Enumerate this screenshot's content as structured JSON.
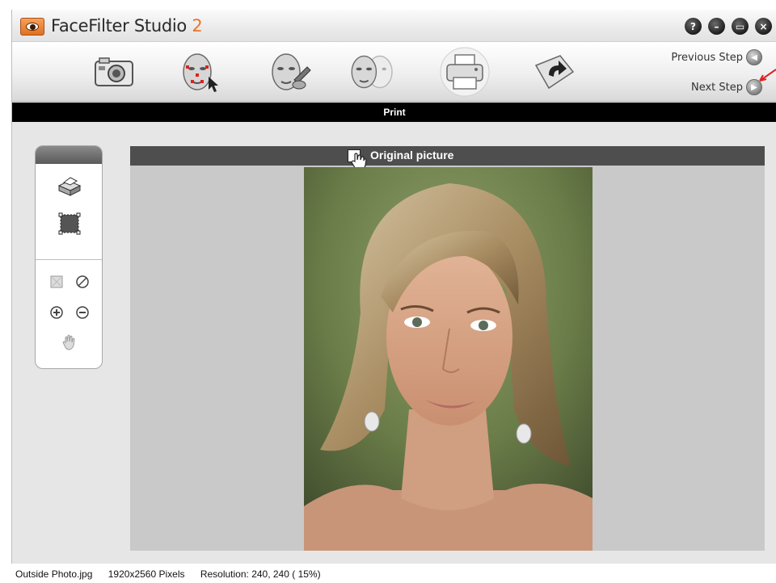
{
  "app": {
    "title": "FaceFilter Studio ",
    "version": "2"
  },
  "window_buttons": [
    {
      "name": "help-button",
      "glyph": "?"
    },
    {
      "name": "minimize-button",
      "glyph": "–"
    },
    {
      "name": "maximize-button",
      "glyph": "▭"
    },
    {
      "name": "close-button",
      "glyph": "×"
    }
  ],
  "toolbar": {
    "steps": [
      "camera-icon",
      "face-select-icon",
      "face-edit-icon",
      "face-compare-icon",
      "printer-icon",
      "undo-icon"
    ],
    "previous_step": "Previous Step",
    "next_step": "Next Step"
  },
  "step_header": "Print",
  "side_panel": {
    "tools": [
      "print-tool-icon",
      "crop-tool-icon",
      "fit-icon",
      "cancel-icon",
      "zoom-in-icon",
      "zoom-out-icon",
      "hand-icon"
    ]
  },
  "preview": {
    "header_label": "Original picture",
    "checkbox_checked": false
  },
  "status": {
    "filename": "Outside Photo.jpg",
    "dimensions": "1920x2560 Pixels",
    "resolution": "Resolution: 240, 240 ( 15%)"
  },
  "colors": {
    "accent": "#e8752a",
    "header_bg": "#000000",
    "preview_bg": "#c9c9c9"
  }
}
